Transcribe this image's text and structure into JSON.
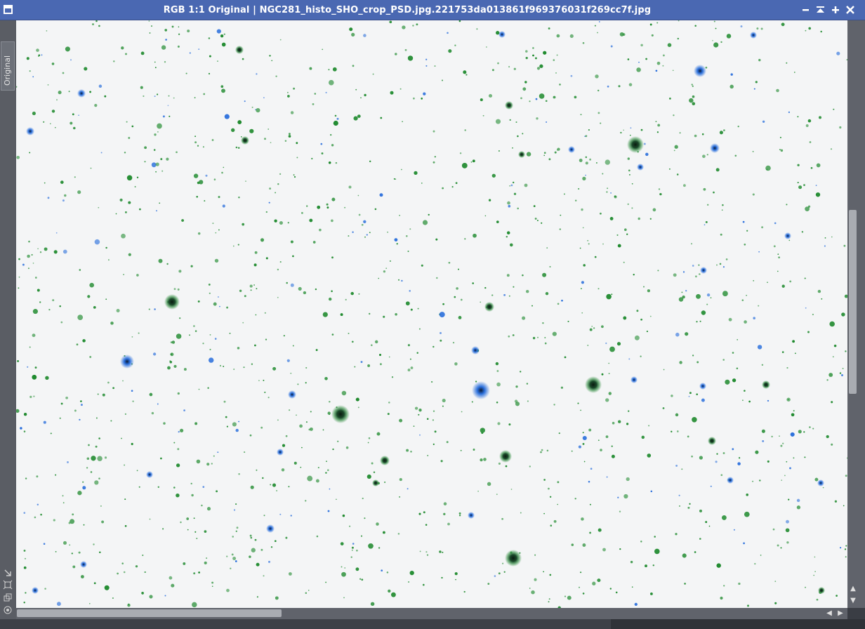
{
  "window": {
    "title": "RGB 1:1 Original | NGC281_histo_SHO_crop_PSD.jpg.221753da013861f969376031f269cc7f.jpg",
    "buttons": {
      "minimize_icon": "minus-icon",
      "shade_icon": "shade-up-icon",
      "maximize_icon": "plus-icon",
      "close_icon": "close-icon"
    }
  },
  "sidebar": {
    "tab_label": "Original",
    "icons": [
      "arrow-resize-icon",
      "fit-view-icon",
      "clone-icon",
      "target-icon"
    ]
  },
  "image": {
    "background_color": "#f4f5f6",
    "star_colors": {
      "green": "#1f8a2e",
      "blue": "#2a6fdc",
      "dark_core": "#0d2a14"
    }
  },
  "colors": {
    "titlebar": "#4a68b2",
    "chrome": "#5a5d64"
  }
}
